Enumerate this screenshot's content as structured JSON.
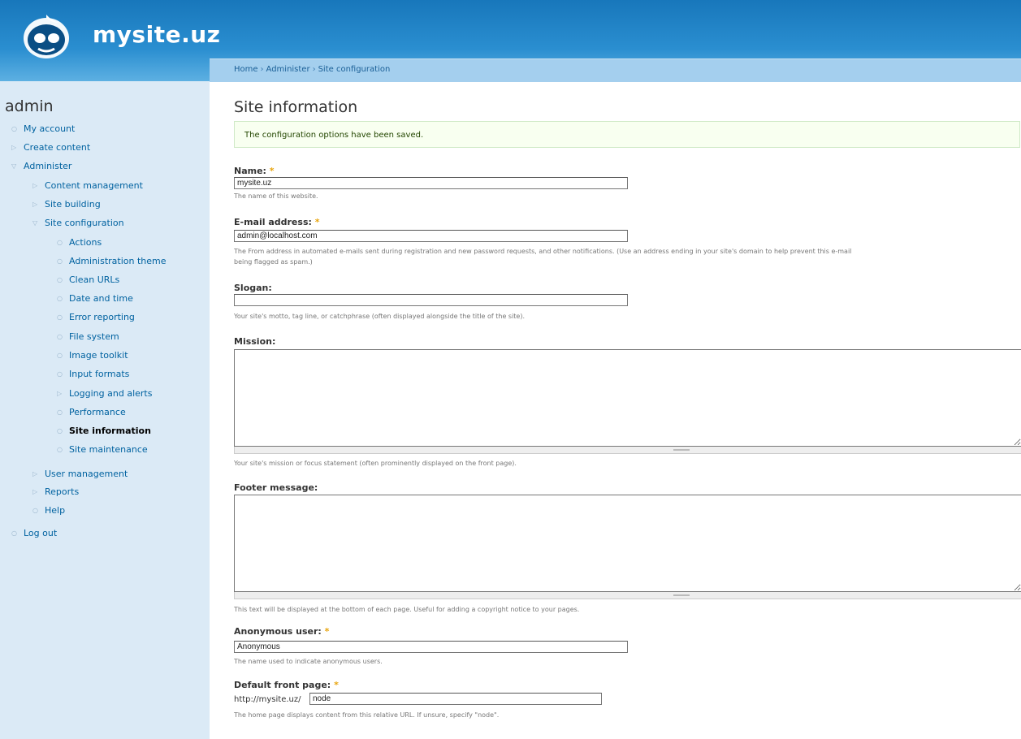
{
  "header": {
    "site_name": "mysite.uz"
  },
  "breadcrumb": [
    "Home",
    "Administer",
    "Site configuration"
  ],
  "sidebar": {
    "user": "admin",
    "menu": [
      {
        "label": "My account"
      },
      {
        "label": "Create content"
      },
      {
        "label": "Administer"
      },
      {
        "label": "Content management"
      },
      {
        "label": "Site building"
      },
      {
        "label": "Site configuration"
      },
      {
        "label": "Actions"
      },
      {
        "label": "Administration theme"
      },
      {
        "label": "Clean URLs"
      },
      {
        "label": "Date and time"
      },
      {
        "label": "Error reporting"
      },
      {
        "label": "File system"
      },
      {
        "label": "Image toolkit"
      },
      {
        "label": "Input formats"
      },
      {
        "label": "Logging and alerts"
      },
      {
        "label": "Performance"
      },
      {
        "label": "Site information"
      },
      {
        "label": "Site maintenance"
      },
      {
        "label": "User management"
      },
      {
        "label": "Reports"
      },
      {
        "label": "Help"
      },
      {
        "label": "Log out"
      }
    ]
  },
  "page": {
    "title": "Site information",
    "status": "The configuration options have been saved."
  },
  "form": {
    "name": {
      "label": "Name:",
      "value": "mysite.uz",
      "desc": "The name of this website."
    },
    "email": {
      "label": "E-mail address:",
      "value": "admin@localhost.com",
      "desc1": "The From address in automated e-mails sent during registration and new password requests, and other notifications. (Use an address ending in your site's domain to help prevent this e-mail",
      "desc2": "being flagged as spam.)"
    },
    "slogan": {
      "label": "Slogan:",
      "value": "",
      "desc": "Your site's motto, tag line, or catchphrase (often displayed alongside the title of the site)."
    },
    "mission": {
      "label": "Mission:",
      "value": "",
      "desc": "Your site's mission or focus statement (often prominently displayed on the front page)."
    },
    "footer": {
      "label": "Footer message:",
      "value": "",
      "desc": "This text will be displayed at the bottom of each page. Useful for adding a copyright notice to your pages."
    },
    "anonymous": {
      "label": "Anonymous user:",
      "value": "Anonymous",
      "desc": "The name used to indicate anonymous users."
    },
    "front_page": {
      "label": "Default front page:",
      "prefix": "http://mysite.uz/",
      "value": "node",
      "desc": "The home page displays content from this relative URL. If unsure, specify \"node\"."
    },
    "required_mark": "*"
  },
  "colors": {
    "header": "#1877bb",
    "sidebar": "#dbeaf6",
    "link": "#0062a0",
    "required": "#e8a50e"
  }
}
